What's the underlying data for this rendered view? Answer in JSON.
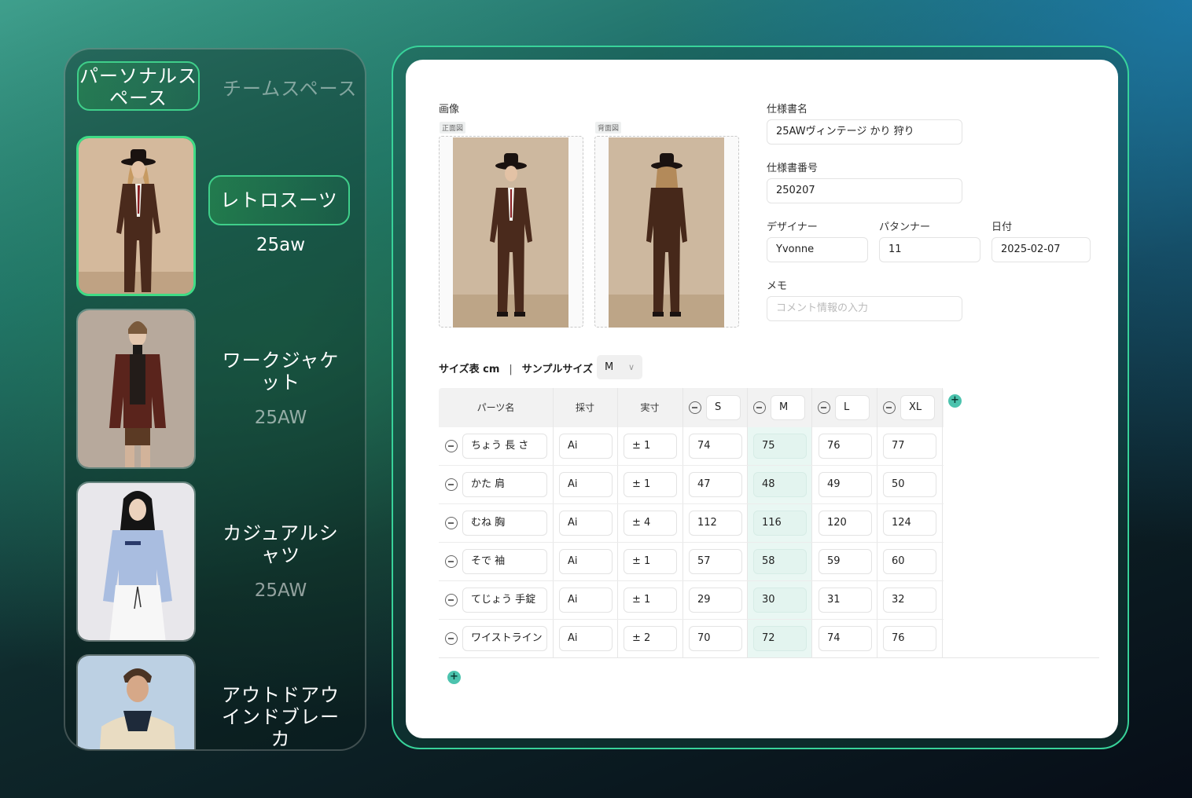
{
  "left": {
    "tabs": {
      "personal": "パーソナルスペース",
      "team": "チームスペース"
    },
    "cards": [
      {
        "title": "レトロスーツ",
        "sub": "25aw",
        "active": true
      },
      {
        "title": "ワークジャケット",
        "sub": "25AW"
      },
      {
        "title": "カジュアルシャツ",
        "sub": "25AW"
      },
      {
        "title": "アウトドアウインドブレーカ",
        "sub": ""
      }
    ]
  },
  "form": {
    "image_label": "画像",
    "front_tag": "正面図",
    "back_tag": "背面図",
    "spec_name_label": "仕様書名",
    "spec_name_value": "25AWヴィンテージ かり 狩り",
    "spec_no_label": "仕様書番号",
    "spec_no_value": "250207",
    "designer_label": "デザイナー",
    "designer_value": "Yvonne",
    "patterner_label": "パタンナー",
    "patterner_value": "11",
    "date_label": "日付",
    "date_value": "2025-02-07",
    "memo_label": "メモ",
    "memo_placeholder": "コメント情報の入力"
  },
  "size_table": {
    "title": "サイズ表 cm",
    "separator": "|",
    "sample_label": "サンプルサイズ",
    "sample_value": "M",
    "headers": {
      "part": "パーツ名",
      "method": "採寸",
      "tolerance": "実寸"
    },
    "sizes": [
      "S",
      "M",
      "L",
      "XL"
    ],
    "rows": [
      {
        "part": "ちょう 長 さ",
        "method": "Ai",
        "tol": "± 1",
        "vals": [
          "74",
          "75",
          "76",
          "77"
        ]
      },
      {
        "part": "かた 肩",
        "method": "Ai",
        "tol": "± 1",
        "vals": [
          "47",
          "48",
          "49",
          "50"
        ]
      },
      {
        "part": "むね 胸",
        "method": "Ai",
        "tol": "± 4",
        "vals": [
          "112",
          "116",
          "120",
          "124"
        ]
      },
      {
        "part": "そで 袖",
        "method": "Ai",
        "tol": "± 1",
        "vals": [
          "57",
          "58",
          "59",
          "60"
        ]
      },
      {
        "part": "てじょう 手錠",
        "method": "Ai",
        "tol": "± 1",
        "vals": [
          "29",
          "30",
          "31",
          "32"
        ]
      },
      {
        "part": "ワイストライン",
        "method": "Ai",
        "tol": "± 2",
        "vals": [
          "70",
          "72",
          "74",
          "76"
        ]
      }
    ]
  },
  "colors": {
    "accent": "#3fcf8a",
    "teal": "#4cc3ae",
    "highlight": "#e3f4ef"
  }
}
